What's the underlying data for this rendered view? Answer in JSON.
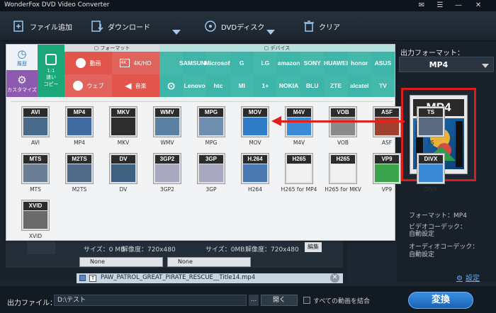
{
  "app": {
    "title": "WonderFox DVD Video Converter"
  },
  "window_controls": [
    "✉",
    "☰",
    "—",
    "✕"
  ],
  "toolbar": {
    "add_file": "ファイル追加",
    "download": "ダウンロード",
    "dvd_disc": "DVDディスク",
    "clear": "クリア"
  },
  "categories": {
    "format_header": "フォーマット",
    "device_header": "デバイス",
    "history": "履歴",
    "customize": "カスタマイズ",
    "copy_1to1": "1:1\n速い\nコピー",
    "video": "動画",
    "hd4k": "4K/HD",
    "web": "ウェブ",
    "music": "音楽"
  },
  "devices_row1": [
    "",
    "SAMSUNG",
    "Microsoft",
    "G",
    "LG",
    "amazon",
    "SONY",
    "HUAWEI",
    "honor",
    "ASUS"
  ],
  "devices_row2": [
    "",
    "Lenovo",
    "htc",
    "MI",
    "1+",
    "NOKIA",
    "BLU",
    "ZTE",
    "alcatel",
    "TV"
  ],
  "formats": [
    {
      "label": "AVI",
      "name": "AVI"
    },
    {
      "label": "MP4",
      "name": "MP4"
    },
    {
      "label": "MKV",
      "name": "MKV"
    },
    {
      "label": "WMV",
      "name": "WMV"
    },
    {
      "label": "MPG",
      "name": "MPG"
    },
    {
      "label": "MOV",
      "name": "MOV"
    },
    {
      "label": "M4V",
      "name": "M4V"
    },
    {
      "label": "VOB",
      "name": "VOB"
    },
    {
      "label": "ASF",
      "name": "ASF"
    },
    {
      "label": "TS",
      "name": "TS"
    },
    {
      "label": "MTS",
      "name": "MTS"
    },
    {
      "label": "M2TS",
      "name": "M2TS"
    },
    {
      "label": "DV",
      "name": "DV"
    },
    {
      "label": "3GP2",
      "name": "3GP2"
    },
    {
      "label": "3GP",
      "name": "3GP"
    },
    {
      "label": "H.264",
      "name": "H264"
    },
    {
      "label": "H265",
      "name": "H265 for MP4"
    },
    {
      "label": "H265",
      "name": "H265 for MKV"
    },
    {
      "label": "VP9",
      "name": "VP9"
    },
    {
      "label": "DIVX",
      "name": "DIVX"
    },
    {
      "label": "XVID",
      "name": "XVID"
    }
  ],
  "output_panel": {
    "label": "出力フォーマット：",
    "selected": "MP4",
    "big_icon_label": "MP4",
    "format_info": "フォーマット：MP4",
    "video_codec_label": "ビデオコーデック：",
    "video_codec_value": "自動設定",
    "audio_codec_label": "オーディオコーデック：",
    "audio_codec_value": "自動設定",
    "settings": "設定"
  },
  "task": {
    "size1": "サイズ：0 MB",
    "res1": "解像度：720x480",
    "size2": "サイズ：0MB",
    "res2": "解像度：720x480",
    "sub1": "None",
    "sub2": "None",
    "edit": "編集",
    "filename": "PAW_PATROL_GREAT_PIRATE_RESCUE__Title14.mp4"
  },
  "bottom": {
    "output_file_label": "出力ファイル：",
    "output_path": "D:\\テスト",
    "browse": "...",
    "open": "開く",
    "merge_label": "すべての動画を結合",
    "convert": "変換"
  }
}
